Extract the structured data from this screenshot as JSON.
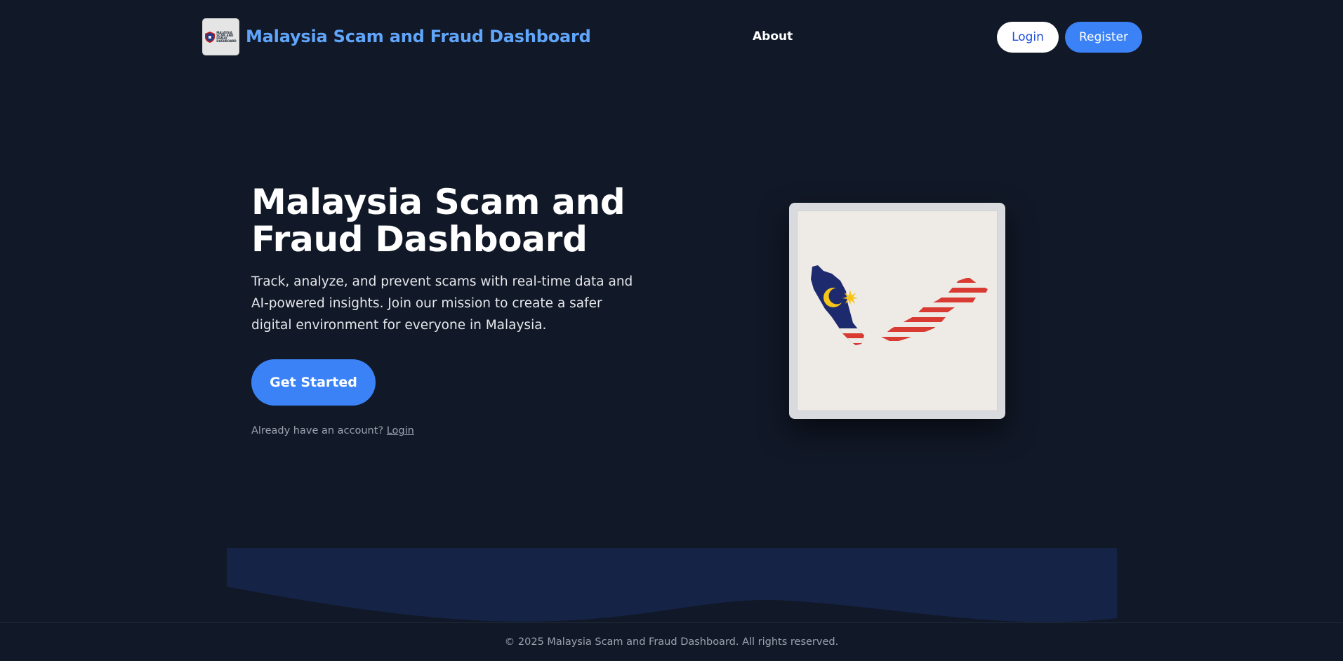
{
  "header": {
    "brand": "Malaysia Scam and Fraud Dashboard",
    "logo_text": [
      "MALAYSIA",
      "SCAM AND",
      "FRAUD",
      "DASHBOARD"
    ],
    "nav": {
      "about": "About"
    },
    "login_label": "Login",
    "register_label": "Register"
  },
  "hero": {
    "title": "Malaysia Scam and Fraud Dashboard",
    "description": "Track, analyze, and prevent scams with real-time data and AI-powered insights. Join our mission to create a safer digital environment for everyone in Malaysia.",
    "cta_label": "Get Started",
    "account_prompt": "Already have an account?",
    "account_login": "Login",
    "image_icon": "malaysia-flag-map-icon"
  },
  "footer": {
    "text": "© 2025 Malaysia Scam and Fraud Dashboard. All rights reserved."
  },
  "colors": {
    "background": "#111827",
    "accent": "#3b82f6",
    "brand_text": "#60a5fa",
    "wave_fill": "#152347",
    "flag_blue": "#1e2a6e",
    "flag_red": "#d93a32",
    "flag_yellow": "#f5c518"
  }
}
